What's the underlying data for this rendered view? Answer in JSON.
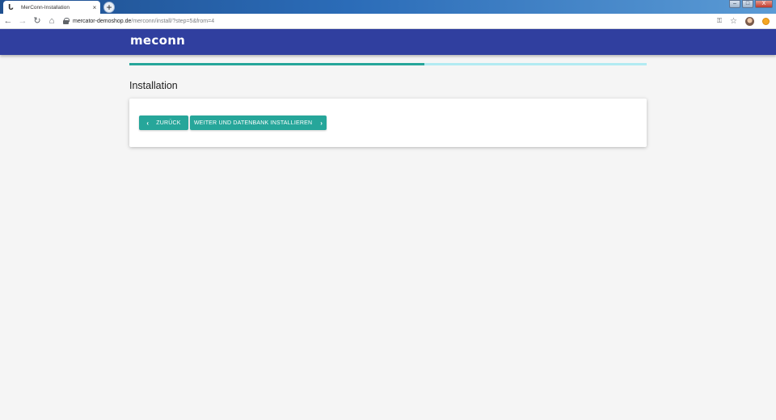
{
  "browser": {
    "tab_title": "MerConn-Installation",
    "tab_close": "×",
    "new_tab": "+",
    "url_host": "mercator-demoshop.de",
    "url_path": "/merconn/install/?step=5&from=4",
    "window_controls": {
      "minimize": "–",
      "maximize": "□",
      "close": "X"
    }
  },
  "header": {
    "logo": "meconn",
    "background": "#303f9f"
  },
  "progress": {
    "fraction": 0.57,
    "fill_color": "#26a69a",
    "track_color": "#b2ebf2"
  },
  "main": {
    "title": "Installation",
    "buttons": {
      "back_label": "ZURÜCK",
      "next_label": "WEITER UND DATENBANK INSTALLIEREN"
    }
  },
  "colors": {
    "accent": "#26a69a",
    "page_bg": "#f5f5f5"
  }
}
